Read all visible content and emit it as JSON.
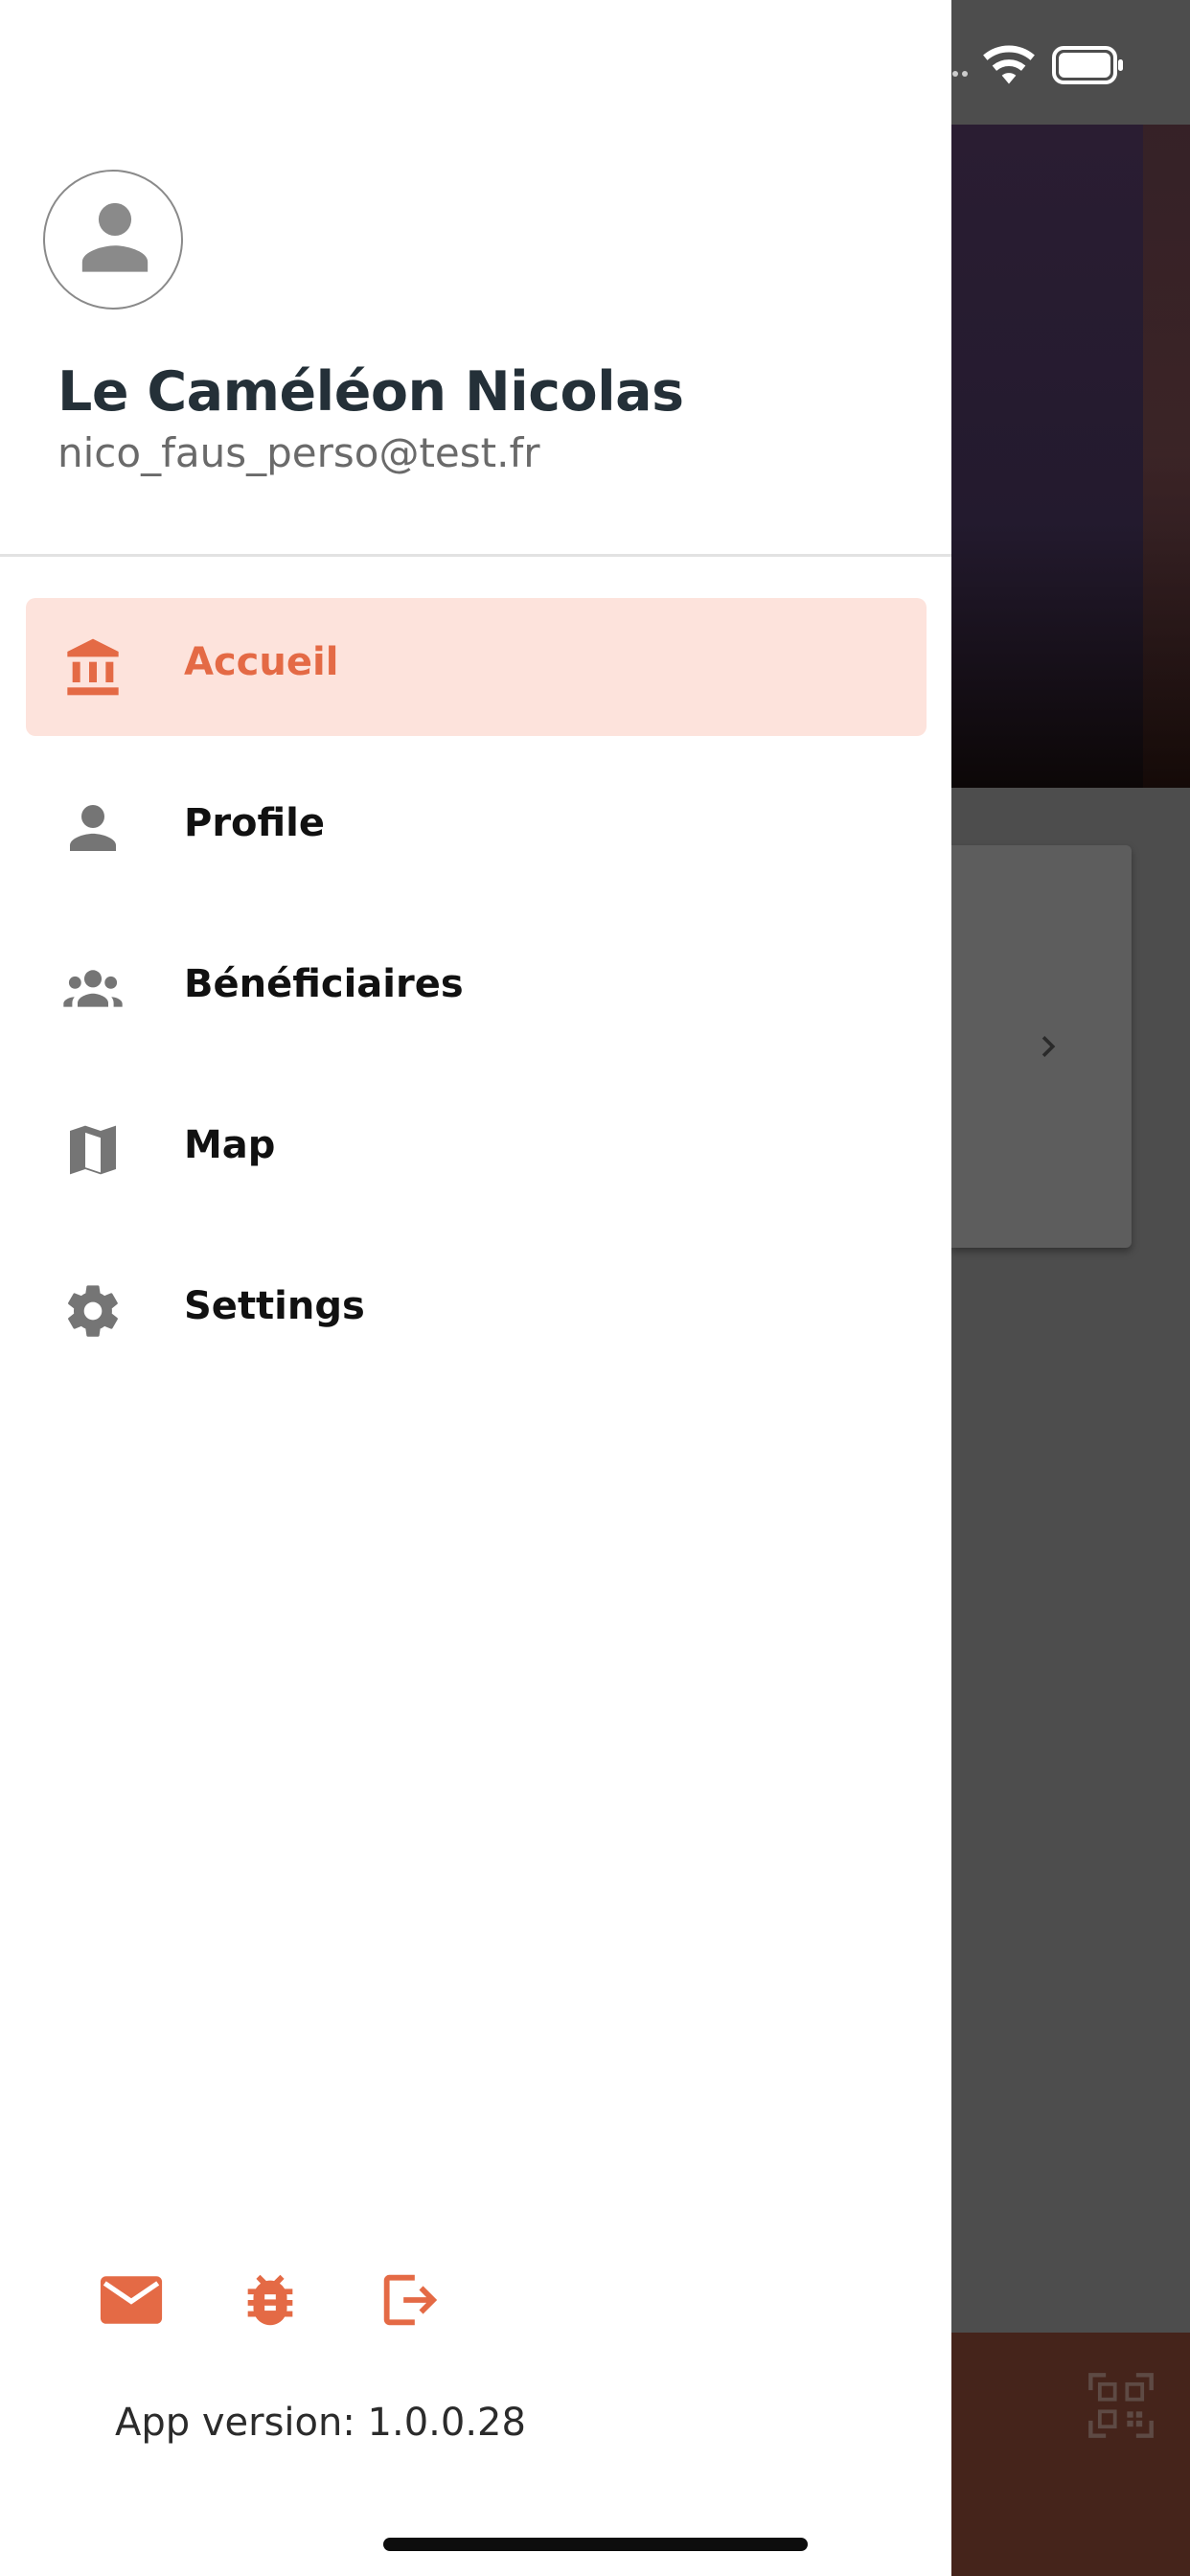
{
  "colors": {
    "accent": "#e46a45",
    "active_bg": "#fde3dc",
    "icon_gray": "#757575",
    "name_color": "#243038"
  },
  "user": {
    "avatar_icon": "person-icon",
    "name": "Le Caméléon Nicolas",
    "email": "nico_faus_perso@test.fr"
  },
  "nav": {
    "items": [
      {
        "label": "Accueil",
        "icon": "bank-icon",
        "active": true
      },
      {
        "label": "Profile",
        "icon": "person-icon",
        "active": false
      },
      {
        "label": "Bénéficiaires",
        "icon": "group-icon",
        "active": false
      },
      {
        "label": "Map",
        "icon": "map-icon",
        "active": false
      },
      {
        "label": "Settings",
        "icon": "gear-icon",
        "active": false
      }
    ]
  },
  "footer": {
    "icons": [
      "mail-icon",
      "bug-icon",
      "logout-icon"
    ],
    "version": "App version: 1.0.0.28"
  }
}
